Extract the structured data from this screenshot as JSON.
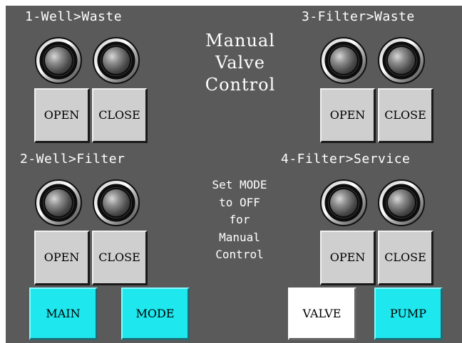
{
  "screen": {
    "title_lines": [
      "Manual",
      "Valve",
      "Control"
    ],
    "note_lines": [
      "Set MODE",
      "to OFF",
      "for",
      "Manual",
      "Control"
    ]
  },
  "valves": [
    {
      "id": "1",
      "label": "1-Well>Waste",
      "open_label": "OPEN",
      "close_label": "CLOSE"
    },
    {
      "id": "2",
      "label": "2-Well>Filter",
      "open_label": "OPEN",
      "close_label": "CLOSE"
    },
    {
      "id": "3",
      "label": "3-Filter>Waste",
      "open_label": "OPEN",
      "close_label": "CLOSE"
    },
    {
      "id": "4",
      "label": "4-Filter>Service",
      "open_label": "OPEN",
      "close_label": "CLOSE"
    }
  ],
  "nav": {
    "main": "MAIN",
    "mode": "MODE",
    "valve": "VALVE",
    "pump": "PUMP"
  },
  "colors": {
    "panel_bg": "#5a5a5a",
    "button_gray": "#cfcfcf",
    "button_cyan": "#1ee8ee",
    "button_white": "#ffffff"
  }
}
